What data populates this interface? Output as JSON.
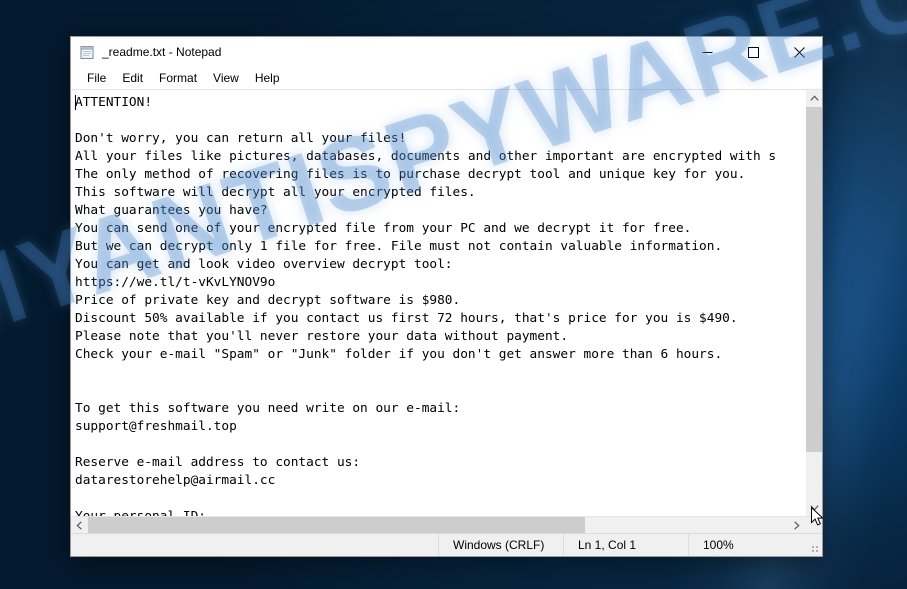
{
  "desktop": {
    "watermark_text": "MYANTISPYWARE.COM",
    "background_color": "#062740"
  },
  "window": {
    "title": "_readme.txt - Notepad",
    "icon": "notepad-icon",
    "controls": {
      "minimize_label": "—",
      "maximize_label": "☐",
      "close_label": "✕"
    },
    "menu": [
      {
        "label": "File"
      },
      {
        "label": "Edit"
      },
      {
        "label": "Format"
      },
      {
        "label": "View"
      },
      {
        "label": "Help"
      }
    ],
    "editor": {
      "content": "ATTENTION!\n\nDon't worry, you can return all your files!\nAll your files like pictures, databases, documents and other important are encrypted with s\nThe only method of recovering files is to purchase decrypt tool and unique key for you.\nThis software will decrypt all your encrypted files.\nWhat guarantees you have?\nYou can send one of your encrypted file from your PC and we decrypt it for free.\nBut we can decrypt only 1 file for free. File must not contain valuable information.\nYou can get and look video overview decrypt tool:\nhttps://we.tl/t-vKvLYNOV9o\nPrice of private key and decrypt software is $980.\nDiscount 50% available if you contact us first 72 hours, that's price for you is $490.\nPlease note that you'll never restore your data without payment.\nCheck your e-mail \"Spam\" or \"Junk\" folder if you don't get answer more than 6 hours.\n\n\nTo get this software you need write on our e-mail:\nsupport@freshmail.top\n\nReserve e-mail address to contact us:\ndatarestorehelp@airmail.cc\n\nYour personal ID:"
    },
    "scrollbars": {
      "vertical_up_arrow": "˄",
      "vertical_down_arrow": "˅",
      "horizontal_left_arrow": "‹",
      "horizontal_right_arrow": "›"
    },
    "statusbar": {
      "line_ending": "Windows (CRLF)",
      "cursor_position": "Ln 1, Col 1",
      "zoom": "100%"
    }
  }
}
